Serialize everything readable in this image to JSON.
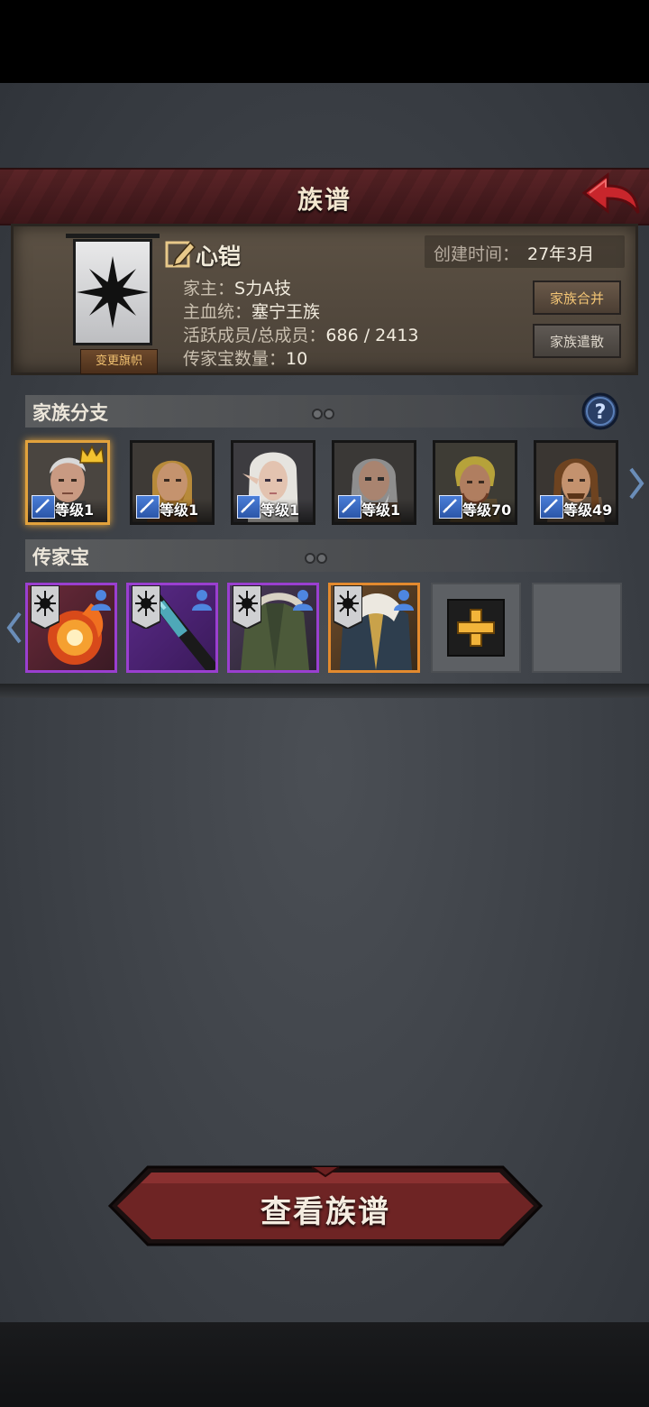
{
  "header": {
    "title": "族谱",
    "back": "back-arrow-icon"
  },
  "family": {
    "name": "心铠",
    "change_banner_label": "变更旗帜",
    "created_label": "创建时间：",
    "created_value": "27年3月",
    "head_label": "家主：",
    "head_value": "S力A技",
    "bloodline_label": "主血统：",
    "bloodline_value": "塞宁王族",
    "members_label": "活跃成员/总成员：",
    "members_value": "686 / 2413",
    "heirloom_count_label": "传家宝数量：",
    "heirloom_count_value": "10",
    "merge_label": "家族合并",
    "disband_label": "家族遣散"
  },
  "branches": {
    "title": "家族分支",
    "members": [
      {
        "level": "等级1",
        "leader": true
      },
      {
        "level": "等级1"
      },
      {
        "level": "等级1"
      },
      {
        "level": "等级1"
      },
      {
        "level": "等级70"
      },
      {
        "level": "等级49"
      }
    ]
  },
  "heirlooms": {
    "title": "传家宝",
    "items": [
      {
        "name": "flaming-orb",
        "rarity": "purple"
      },
      {
        "name": "spiked-mace",
        "rarity": "purple"
      },
      {
        "name": "green-coat",
        "rarity": "purple"
      },
      {
        "name": "fur-cloak",
        "rarity": "orange"
      }
    ]
  },
  "footer": {
    "view_button_label": "查看族谱"
  },
  "colors": {
    "title_bar": "#4e1d20",
    "panel": "#544a3f",
    "accent_gold": "#e2a23c",
    "rarity_purple": "#9a3fd0",
    "rarity_orange": "#e38a2e"
  }
}
